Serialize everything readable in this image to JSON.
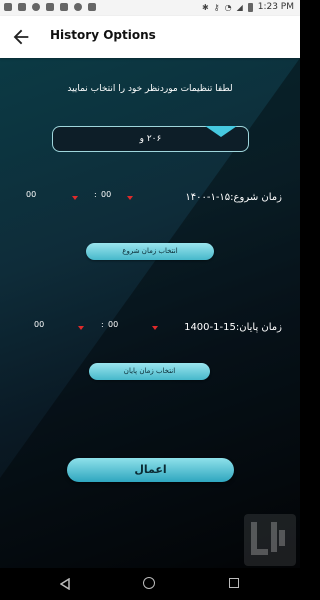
{
  "status_bar": {
    "time": "1:23 PM",
    "icons": [
      "notification-icon",
      "notification-icon",
      "notification-icon",
      "notification-icon",
      "notification-icon",
      "notification-icon",
      "notification-icon",
      "bluetooth-icon",
      "key-icon",
      "wifi-icon",
      "signal-icon",
      "battery-icon"
    ]
  },
  "app_bar": {
    "title": "History Options",
    "back_icon": "arrow-left-icon"
  },
  "form": {
    "prompt": "لطفا تنظیمات موردنظر خود را انتخاب نمایید",
    "vehicle_selected": "۲۰۶ و",
    "start": {
      "label": "زمان شروع:۱۵-۱-۱۴۰۰",
      "hour": "00",
      "separator": ":",
      "minute": "00",
      "button": "انتخاب زمان شروع"
    },
    "end": {
      "label": "زمان پایان:15-1-1400",
      "hour": "00",
      "separator": ":",
      "minute": "00",
      "button": "انتخاب زمان پایان"
    },
    "apply_button": "اعمال"
  },
  "nav_bar": {
    "icons": [
      "back-triangle-icon",
      "home-circle-icon",
      "recents-square-icon"
    ]
  },
  "colors": {
    "accent": "#46c9e0",
    "button": "#5ec4d4",
    "caret": "#e02a2a"
  }
}
